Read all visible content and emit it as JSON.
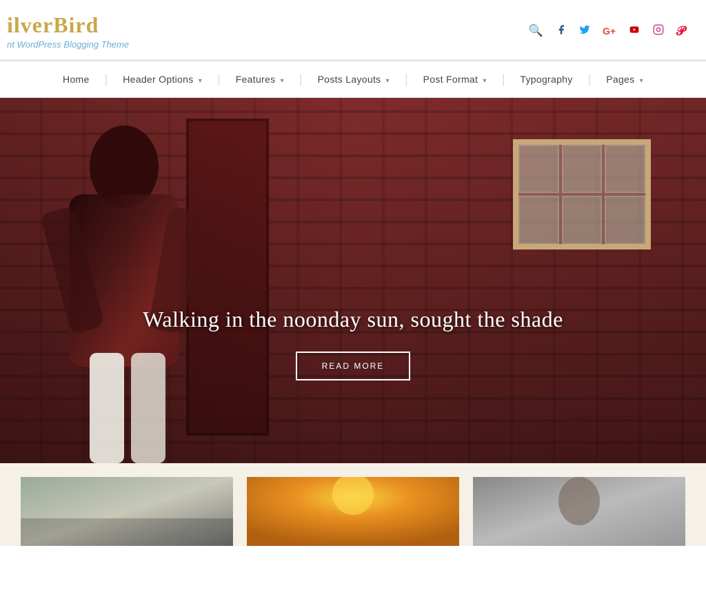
{
  "site": {
    "logo_title": "ilverBird",
    "logo_subtitle": "nt WordPress Blogging Theme"
  },
  "social": {
    "search_icon": "🔍",
    "facebook_icon": "f",
    "twitter_icon": "t",
    "gplus_icon": "G+",
    "youtube_icon": "▶",
    "instagram_icon": "📷",
    "pinterest_icon": "P"
  },
  "nav": {
    "items": [
      {
        "label": "Home",
        "has_arrow": false
      },
      {
        "label": "Header Options",
        "has_arrow": true
      },
      {
        "label": "Features",
        "has_arrow": true
      },
      {
        "label": "Posts Layouts",
        "has_arrow": true
      },
      {
        "label": "Post Format",
        "has_arrow": true
      },
      {
        "label": "Typography",
        "has_arrow": false
      },
      {
        "label": "Pages",
        "has_arrow": true
      }
    ]
  },
  "hero": {
    "title": "Walking in the noonday sun, sought the shade",
    "cta_label": "READ MORE"
  },
  "colors": {
    "logo_gold": "#c8a84b",
    "subtitle_blue": "#6baed6",
    "nav_text": "#444",
    "hero_bg": "#8b3030",
    "white": "#ffffff"
  }
}
